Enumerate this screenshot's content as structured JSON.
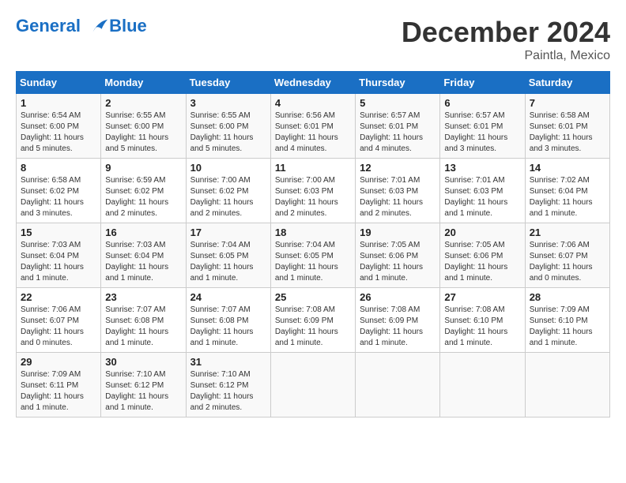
{
  "header": {
    "logo_line1": "General",
    "logo_line2": "Blue",
    "month": "December 2024",
    "location": "Paintla, Mexico"
  },
  "weekdays": [
    "Sunday",
    "Monday",
    "Tuesday",
    "Wednesday",
    "Thursday",
    "Friday",
    "Saturday"
  ],
  "weeks": [
    [
      {
        "day": "1",
        "sunrise": "6:54 AM",
        "sunset": "6:00 PM",
        "daylight": "11 hours and 5 minutes."
      },
      {
        "day": "2",
        "sunrise": "6:55 AM",
        "sunset": "6:00 PM",
        "daylight": "11 hours and 5 minutes."
      },
      {
        "day": "3",
        "sunrise": "6:55 AM",
        "sunset": "6:00 PM",
        "daylight": "11 hours and 5 minutes."
      },
      {
        "day": "4",
        "sunrise": "6:56 AM",
        "sunset": "6:01 PM",
        "daylight": "11 hours and 4 minutes."
      },
      {
        "day": "5",
        "sunrise": "6:57 AM",
        "sunset": "6:01 PM",
        "daylight": "11 hours and 4 minutes."
      },
      {
        "day": "6",
        "sunrise": "6:57 AM",
        "sunset": "6:01 PM",
        "daylight": "11 hours and 3 minutes."
      },
      {
        "day": "7",
        "sunrise": "6:58 AM",
        "sunset": "6:01 PM",
        "daylight": "11 hours and 3 minutes."
      }
    ],
    [
      {
        "day": "8",
        "sunrise": "6:58 AM",
        "sunset": "6:02 PM",
        "daylight": "11 hours and 3 minutes."
      },
      {
        "day": "9",
        "sunrise": "6:59 AM",
        "sunset": "6:02 PM",
        "daylight": "11 hours and 2 minutes."
      },
      {
        "day": "10",
        "sunrise": "7:00 AM",
        "sunset": "6:02 PM",
        "daylight": "11 hours and 2 minutes."
      },
      {
        "day": "11",
        "sunrise": "7:00 AM",
        "sunset": "6:03 PM",
        "daylight": "11 hours and 2 minutes."
      },
      {
        "day": "12",
        "sunrise": "7:01 AM",
        "sunset": "6:03 PM",
        "daylight": "11 hours and 2 minutes."
      },
      {
        "day": "13",
        "sunrise": "7:01 AM",
        "sunset": "6:03 PM",
        "daylight": "11 hours and 1 minute."
      },
      {
        "day": "14",
        "sunrise": "7:02 AM",
        "sunset": "6:04 PM",
        "daylight": "11 hours and 1 minute."
      }
    ],
    [
      {
        "day": "15",
        "sunrise": "7:03 AM",
        "sunset": "6:04 PM",
        "daylight": "11 hours and 1 minute."
      },
      {
        "day": "16",
        "sunrise": "7:03 AM",
        "sunset": "6:04 PM",
        "daylight": "11 hours and 1 minute."
      },
      {
        "day": "17",
        "sunrise": "7:04 AM",
        "sunset": "6:05 PM",
        "daylight": "11 hours and 1 minute."
      },
      {
        "day": "18",
        "sunrise": "7:04 AM",
        "sunset": "6:05 PM",
        "daylight": "11 hours and 1 minute."
      },
      {
        "day": "19",
        "sunrise": "7:05 AM",
        "sunset": "6:06 PM",
        "daylight": "11 hours and 1 minute."
      },
      {
        "day": "20",
        "sunrise": "7:05 AM",
        "sunset": "6:06 PM",
        "daylight": "11 hours and 1 minute."
      },
      {
        "day": "21",
        "sunrise": "7:06 AM",
        "sunset": "6:07 PM",
        "daylight": "11 hours and 0 minutes."
      }
    ],
    [
      {
        "day": "22",
        "sunrise": "7:06 AM",
        "sunset": "6:07 PM",
        "daylight": "11 hours and 0 minutes."
      },
      {
        "day": "23",
        "sunrise": "7:07 AM",
        "sunset": "6:08 PM",
        "daylight": "11 hours and 1 minute."
      },
      {
        "day": "24",
        "sunrise": "7:07 AM",
        "sunset": "6:08 PM",
        "daylight": "11 hours and 1 minute."
      },
      {
        "day": "25",
        "sunrise": "7:08 AM",
        "sunset": "6:09 PM",
        "daylight": "11 hours and 1 minute."
      },
      {
        "day": "26",
        "sunrise": "7:08 AM",
        "sunset": "6:09 PM",
        "daylight": "11 hours and 1 minute."
      },
      {
        "day": "27",
        "sunrise": "7:08 AM",
        "sunset": "6:10 PM",
        "daylight": "11 hours and 1 minute."
      },
      {
        "day": "28",
        "sunrise": "7:09 AM",
        "sunset": "6:10 PM",
        "daylight": "11 hours and 1 minute."
      }
    ],
    [
      {
        "day": "29",
        "sunrise": "7:09 AM",
        "sunset": "6:11 PM",
        "daylight": "11 hours and 1 minute."
      },
      {
        "day": "30",
        "sunrise": "7:10 AM",
        "sunset": "6:12 PM",
        "daylight": "11 hours and 1 minute."
      },
      {
        "day": "31",
        "sunrise": "7:10 AM",
        "sunset": "6:12 PM",
        "daylight": "11 hours and 2 minutes."
      },
      null,
      null,
      null,
      null
    ]
  ],
  "labels": {
    "sunrise": "Sunrise:",
    "sunset": "Sunset:",
    "daylight": "Daylight hours"
  }
}
